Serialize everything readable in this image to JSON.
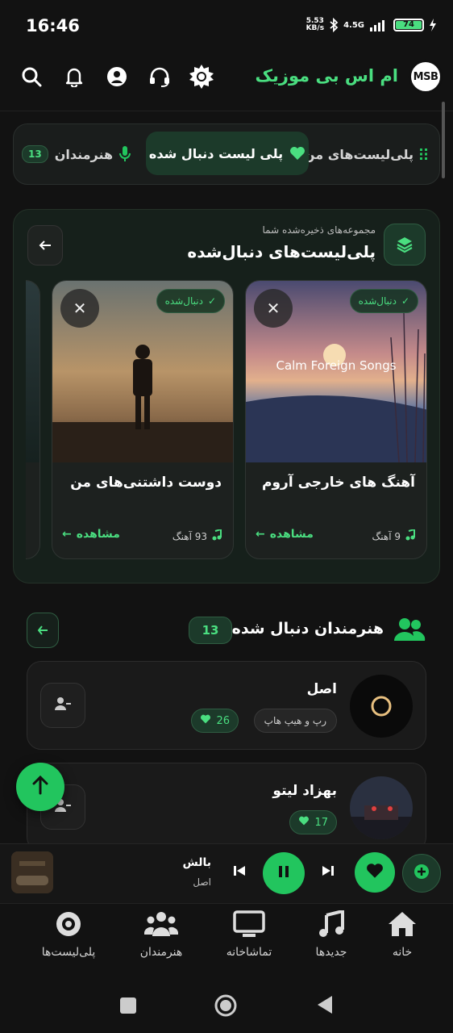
{
  "status_bar": {
    "time": "16:46",
    "net_speed_value": "5.53",
    "net_speed_unit": "KB/s",
    "network": "4.5G",
    "battery": "74"
  },
  "header": {
    "app_title": "ام اس بی موزیک",
    "logo_text": "MSB"
  },
  "tabs": {
    "my_playlists": "پلی‌لیست‌های من",
    "followed_playlists": "پلی لیست دنبال شده",
    "artists": "هنرمندان",
    "artists_count": "13"
  },
  "followed_section": {
    "subtitle": "مجموعه‌های ذخیره‌شده شما",
    "title": "پلی‌لیست‌های دنبال‌شده",
    "cards": [
      {
        "name": "آهنگ های خارجی آروم",
        "cover_text": "Calm Foreign Songs",
        "badge": "دنبال‌شده",
        "count": "9 آهنگ",
        "view": "مشاهده"
      },
      {
        "name": "دوست داشتنی‌های من",
        "cover_text": "",
        "badge": "دنبال‌شده",
        "count": "93 آهنگ",
        "view": "مشاهده"
      }
    ]
  },
  "artists_section": {
    "title": "هنرمندان دنبال شده",
    "count": "13",
    "items": [
      {
        "name": "اصل",
        "genre": "رپ و هیپ هاپ",
        "likes": "26"
      },
      {
        "name": "بهزاد لیتو",
        "genre": "",
        "likes": "17"
      }
    ]
  },
  "player": {
    "title": "بالش",
    "artist": "اصل"
  },
  "bottom_nav": {
    "home": "خانه",
    "new": "جدیدها",
    "theater": "تماشاخانه",
    "artists": "هنرمندان",
    "playlists": "پلی‌لیست‌ها"
  },
  "colors": {
    "accent": "#22c55e",
    "accent_text": "#4ade80",
    "background": "#121212",
    "card": "#1d211f"
  }
}
